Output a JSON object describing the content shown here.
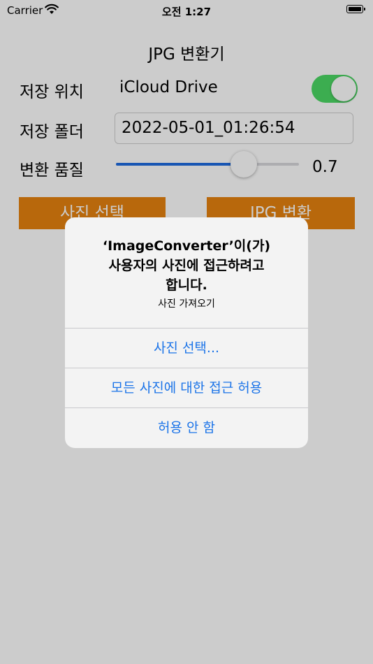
{
  "status_bar": {
    "carrier": "Carrier",
    "time": "오전 1:27"
  },
  "app": {
    "title": "JPG 변환기",
    "save_location": {
      "label": "저장 위치",
      "value": "iCloud Drive",
      "toggle_on": true
    },
    "save_folder": {
      "label": "저장 폴더",
      "value": "2022-05-01_01:26:54"
    },
    "quality": {
      "label": "변환 품질",
      "value": 0.7,
      "display": "0.7"
    },
    "buttons": {
      "select_photo": "사진 선택",
      "convert_jpg": "JPG 변환"
    },
    "accent_color": "#e6830f",
    "toggle_color": "#4cd964",
    "slider_color": "#1f6ce0"
  },
  "alert": {
    "title_line1": "‘ImageConverter’이(가)",
    "title_line2": "사용자의 사진에 접근하려고",
    "title_line3": "합니다.",
    "message": "사진 가져오기",
    "actions": [
      "사진 선택...",
      "모든 사진에 대한 접근 허용",
      "허용 안 함"
    ],
    "action_color": "#1a73e8"
  }
}
